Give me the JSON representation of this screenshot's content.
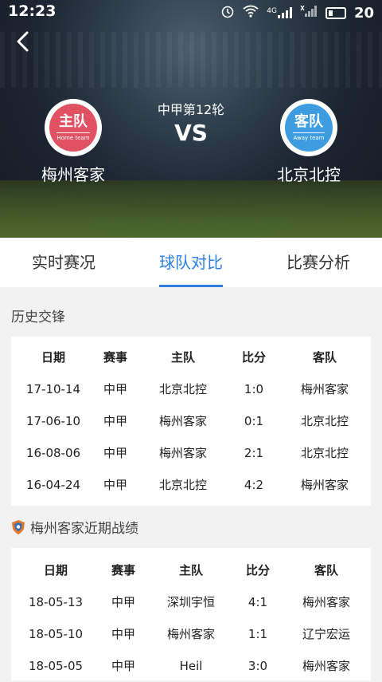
{
  "status_bar": {
    "time": "12:23",
    "battery": "20",
    "network": "4G"
  },
  "match": {
    "round": "中甲第12轮",
    "vs": "VS"
  },
  "home": {
    "logo_text": "主队",
    "logo_sub": "Home team",
    "name": "梅州客家",
    "color": "#e05263"
  },
  "away": {
    "logo_text": "客队",
    "logo_sub": "Away team",
    "name": "北京北控",
    "color": "#3d9de0"
  },
  "tabs": [
    {
      "label": "实时赛况",
      "active": false
    },
    {
      "label": "球队对比",
      "active": true
    },
    {
      "label": "比赛分析",
      "active": false
    }
  ],
  "history": {
    "title": "历史交锋",
    "headers": [
      "日期",
      "赛事",
      "主队",
      "比分",
      "客队"
    ],
    "rows": [
      [
        "17-10-14",
        "中甲",
        "北京北控",
        "1:0",
        "梅州客家"
      ],
      [
        "17-06-10",
        "中甲",
        "梅州客家",
        "0:1",
        "北京北控"
      ],
      [
        "16-08-06",
        "中甲",
        "梅州客家",
        "2:1",
        "北京北控"
      ],
      [
        "16-04-24",
        "中甲",
        "北京北控",
        "4:2",
        "梅州客家"
      ]
    ]
  },
  "recent": {
    "title": "梅州客家近期战绩",
    "headers": [
      "日期",
      "赛事",
      "主队",
      "比分",
      "客队"
    ],
    "rows": [
      [
        "18-05-13",
        "中甲",
        "深圳宇恒",
        "4:1",
        "梅州客家"
      ],
      [
        "18-05-10",
        "中甲",
        "梅州客家",
        "1:1",
        "辽宁宏运"
      ],
      [
        "18-05-05",
        "中甲",
        "Heil",
        "3:0",
        "梅州客家"
      ]
    ]
  },
  "icons": {
    "back": "back-arrow-icon",
    "alarm": "alarm-icon",
    "wifi": "wifi-icon",
    "signal": "signal-icon",
    "battery": "battery-icon",
    "team_badge": "team-shield-icon"
  },
  "accent": "#2f7ee0"
}
